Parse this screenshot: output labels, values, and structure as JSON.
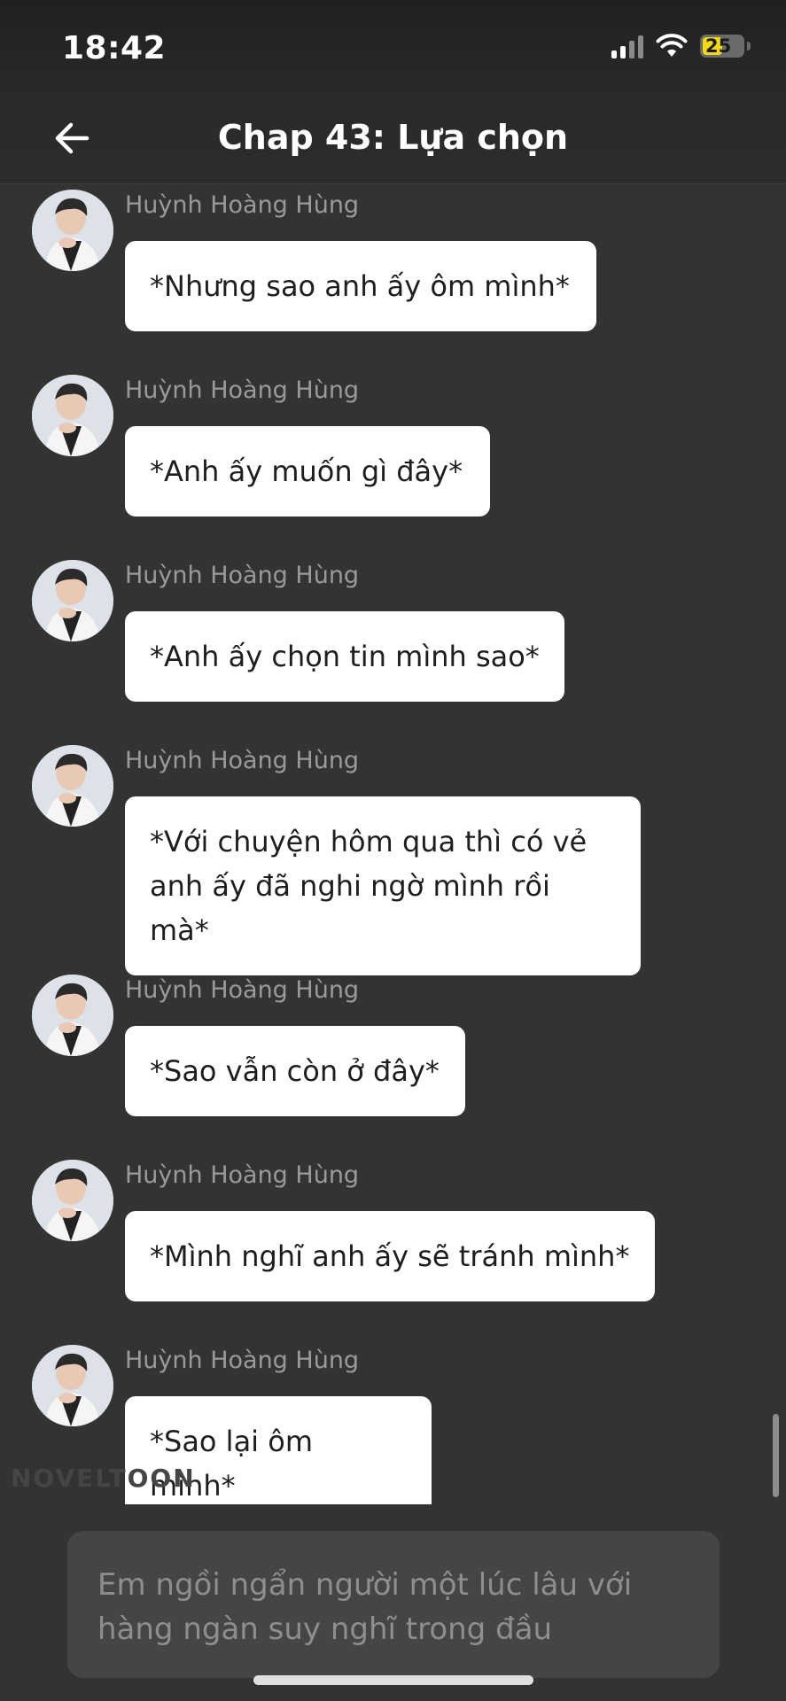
{
  "status_bar": {
    "time": "18:42",
    "battery": "25",
    "battery_color": "#f5d90a",
    "signal_icon": "cellular-signal-icon",
    "wifi_icon": "wifi-icon"
  },
  "header": {
    "back_icon": "arrow-left-icon",
    "title": "Chap 43: Lựa chọn"
  },
  "messages": [
    {
      "sender": "Huỳnh Hoàng Hùng",
      "text": "*Nhưng sao anh ấy ôm mình*"
    },
    {
      "sender": "Huỳnh Hoàng Hùng",
      "text": "*Anh ấy muốn gì đây*"
    },
    {
      "sender": "Huỳnh Hoàng Hùng",
      "text": "*Anh ấy chọn tin mình sao*"
    },
    {
      "sender": "Huỳnh Hoàng Hùng",
      "text": "*Với chuyện hôm qua thì có vẻ anh ấy đã nghi ngờ mình rồi mà*"
    },
    {
      "sender": "Huỳnh Hoàng Hùng",
      "text": "*Sao vẫn còn ở đây*"
    },
    {
      "sender": "Huỳnh Hoàng Hùng",
      "text": "*Mình nghĩ anh ấy sẽ tránh mình*"
    },
    {
      "sender": "Huỳnh Hoàng Hùng",
      "text": "*Sao lại ôm mình*"
    }
  ],
  "watermark": "NOVELTOON",
  "narration": "Em ngồi ngẩn người một lúc lâu với hàng ngàn suy nghĩ trong đầu"
}
